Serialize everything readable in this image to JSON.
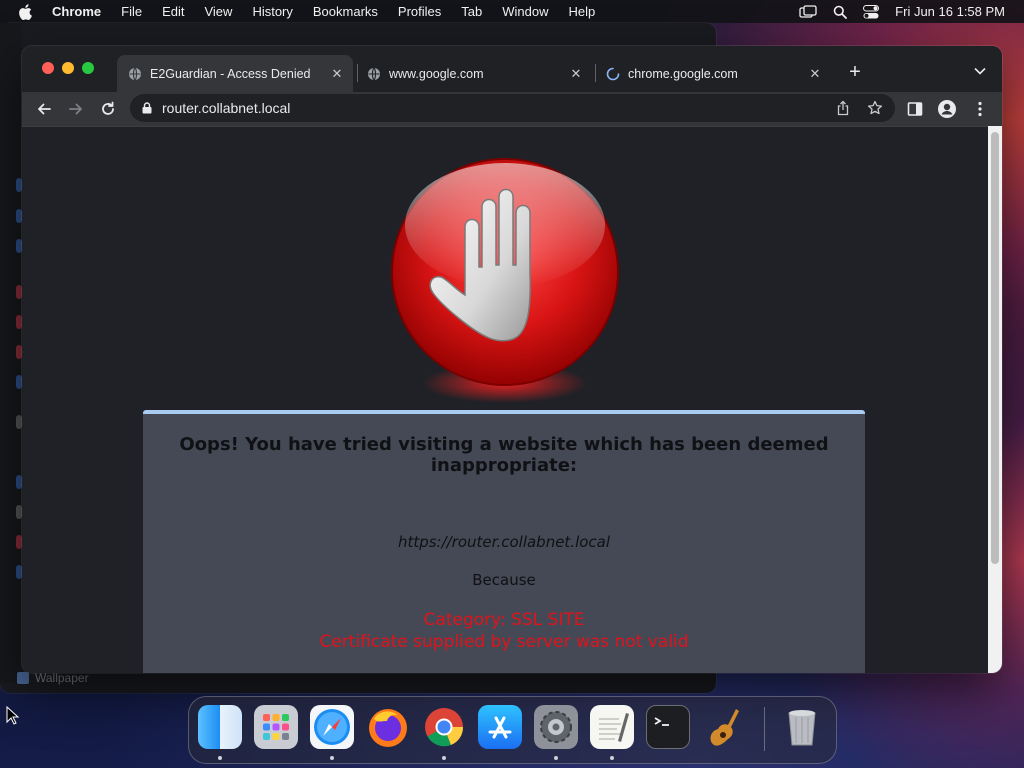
{
  "menubar": {
    "app_name": "Chrome",
    "menus": [
      "File",
      "Edit",
      "View",
      "History",
      "Bookmarks",
      "Profiles",
      "Tab",
      "Window",
      "Help"
    ],
    "clock": "Fri Jun 16  1:58 PM",
    "status_icons": [
      "screen-mirroring-icon",
      "spotlight-search-icon",
      "control-center-icon"
    ]
  },
  "background_window": {
    "wallpaper_label": "Wallpaper"
  },
  "browser": {
    "tabs": [
      {
        "title": "E2Guardian - Access Denied",
        "favicon": "globe-icon",
        "active": true
      },
      {
        "title": "www.google.com",
        "favicon": "globe-icon",
        "active": false
      },
      {
        "title": "chrome.google.com",
        "favicon": "loading-spinner-icon",
        "active": false
      }
    ],
    "address": "router.collabnet.local"
  },
  "page": {
    "headline": "Oops! You have tried visiting a website which has been deemed inappropriate:",
    "blocked_url": "https://router.collabnet.local",
    "because_label": "Because",
    "category": "Category: SSL SITE",
    "reason": "Certificate supplied by server was not valid",
    "colors": {
      "panel_bg": "#454955",
      "panel_border": "#a9cbf2",
      "alert_red": "#e0131b"
    }
  },
  "dock": {
    "apps": [
      {
        "name": "Finder",
        "icon": "finder-icon",
        "running": true
      },
      {
        "name": "Launchpad",
        "icon": "launchpad-icon",
        "running": false
      },
      {
        "name": "Safari",
        "icon": "safari-icon",
        "running": true
      },
      {
        "name": "Firefox",
        "icon": "firefox-icon",
        "running": false
      },
      {
        "name": "Chrome",
        "icon": "chrome-icon",
        "running": true
      },
      {
        "name": "App Store",
        "icon": "app-store-icon",
        "running": false
      },
      {
        "name": "System Settings",
        "icon": "settings-icon",
        "running": true
      },
      {
        "name": "TextEdit",
        "icon": "textedit-icon",
        "running": true
      },
      {
        "name": "Terminal",
        "icon": "terminal-icon",
        "running": false
      },
      {
        "name": "GarageBand",
        "icon": "garageband-icon",
        "running": false
      },
      {
        "name": "Trash",
        "icon": "trash-icon",
        "running": false
      }
    ]
  }
}
